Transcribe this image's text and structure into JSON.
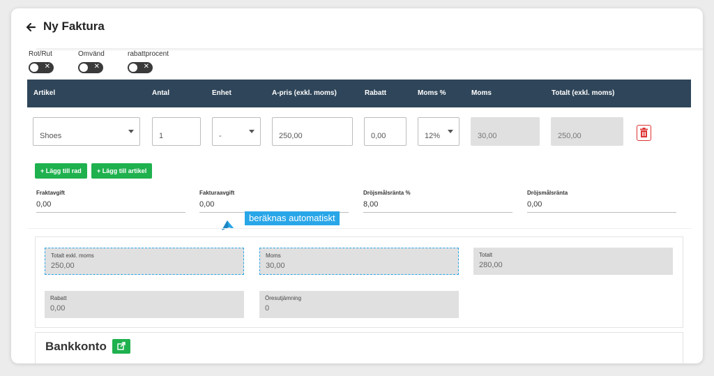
{
  "header": {
    "title": "Ny Faktura"
  },
  "toggles": [
    {
      "label": "Rot/Rut",
      "on": false
    },
    {
      "label": "Omvänd",
      "on": false
    },
    {
      "label": "rabattprocent",
      "on": false
    }
  ],
  "table": {
    "columns": [
      "Artikel",
      "Antal",
      "Enhet",
      "A-pris (exkl. moms)",
      "Rabatt",
      "Moms %",
      "Moms",
      "Totalt (exkl. moms)"
    ],
    "row": {
      "artikel": "Shoes",
      "antal": "1",
      "enhet": "-",
      "apris": "250,00",
      "rabatt": "0,00",
      "moms_pct": "12%",
      "moms": "30,00",
      "totalt": "250,00"
    }
  },
  "buttons": {
    "add_row": "+ Lägg till rad",
    "add_article": "+ Lägg till artikel"
  },
  "fees": [
    {
      "label": "Fraktavgift",
      "value": "0,00"
    },
    {
      "label": "Fakturaavgift",
      "value": "0,00"
    },
    {
      "label": "Dröjsmålsränta %",
      "value": "8,00"
    },
    {
      "label": "Dröjsmålsränta",
      "value": "0,00"
    }
  ],
  "tooltip": "beräknas automatiskt",
  "summary": {
    "totalt_exkl": {
      "label": "Totalt exkl. moms",
      "value": "250,00"
    },
    "moms": {
      "label": "Moms",
      "value": "30,00"
    },
    "totalt": {
      "label": "Totalt",
      "value": "280,00"
    },
    "rabatt": {
      "label": "Rabatt",
      "value": "0,00"
    },
    "oresutjamning": {
      "label": "Öresutjämning",
      "value": "0"
    }
  },
  "bank": {
    "title": "Bankkonto"
  },
  "icons": {
    "back": "arrow-left-icon",
    "delete": "trash-icon",
    "bank_link": "external-link-icon",
    "tooltip_pointer": "cursor-pointer-icon"
  },
  "colors": {
    "header_bg": "#2f4559",
    "green": "#1fb14e",
    "tooltip": "#29a6e8",
    "danger": "#dd3333"
  }
}
